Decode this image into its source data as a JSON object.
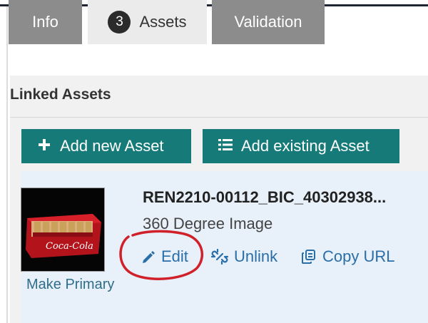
{
  "tabs": [
    {
      "label": "Info"
    },
    {
      "badge": "3",
      "label": "Assets"
    },
    {
      "label": "Validation"
    }
  ],
  "section": {
    "title": "Linked Assets"
  },
  "buttons": {
    "add_new": "Add new Asset",
    "add_existing": "Add existing Asset"
  },
  "asset": {
    "name": "REN2210-00112_BIC_40302938...",
    "type": "360 Degree Image",
    "make_primary": "Make Primary",
    "thumbnail_brand_text": "Coca-Cola",
    "actions": {
      "edit": "Edit",
      "unlink": "Unlink",
      "copy_url": "Copy URL"
    }
  },
  "colors": {
    "accent_teal": "#157a78",
    "link_blue": "#2a6ea8",
    "annotation_red": "#d0202a"
  },
  "icons": [
    "plus-icon",
    "list-icon",
    "pencil-icon",
    "unlink-icon",
    "copy-icon"
  ]
}
